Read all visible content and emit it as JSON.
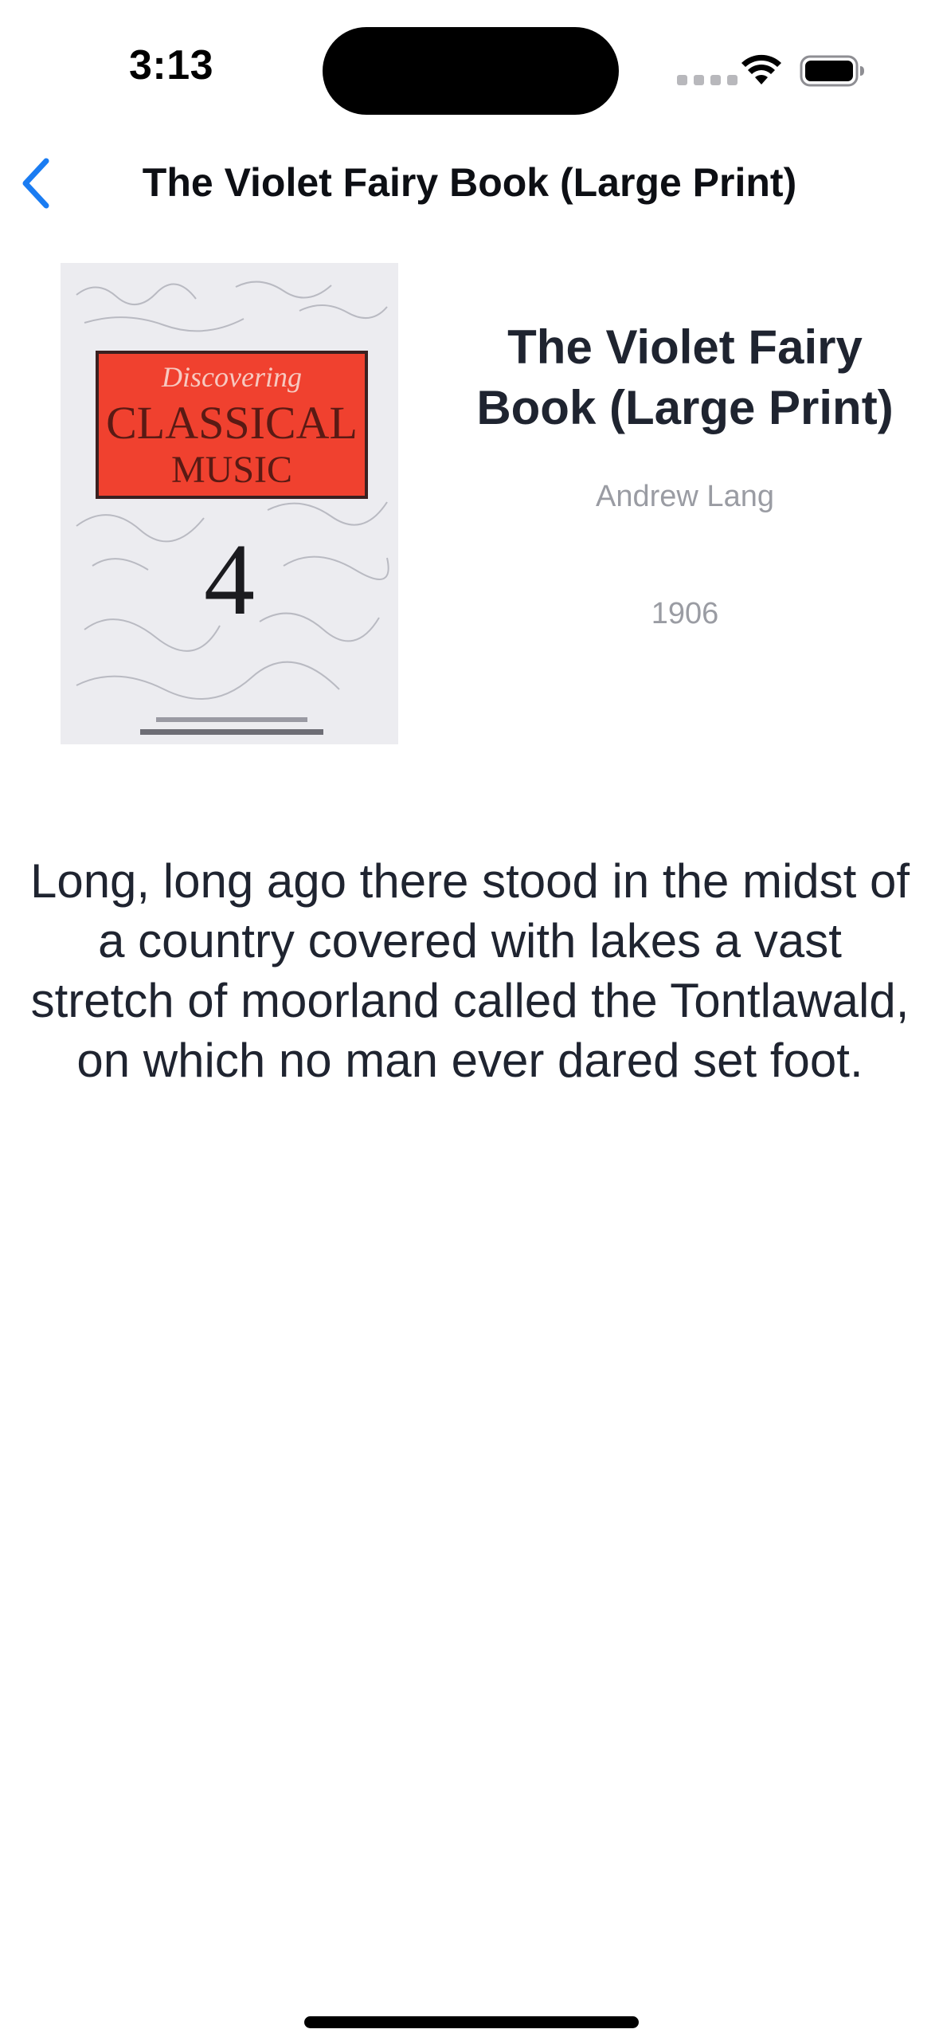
{
  "status_bar": {
    "time": "3:13",
    "icons": [
      "signal-dots-icon",
      "wifi-icon",
      "battery-icon"
    ]
  },
  "nav": {
    "back_icon": "chevron-left-icon",
    "title": "The Violet Fairy Book (Large Print)"
  },
  "book": {
    "title": "The Violet Fairy Book (Large Print)",
    "author": "Andrew Lang",
    "year": "1906",
    "cover": {
      "line1": "Discovering",
      "line2": "CLASSICAL",
      "line3": "MUSIC",
      "number": "4"
    },
    "description": "Long, long ago there stood in the midst of a country covered with lakes a vast stretch of moorland called the Tontlawald, on which no man ever dared set foot."
  },
  "colors": {
    "accent": "#1a7cf2",
    "text_primary": "#1f2430",
    "text_secondary": "#9a9ca3",
    "cover_red": "#f0412f"
  }
}
